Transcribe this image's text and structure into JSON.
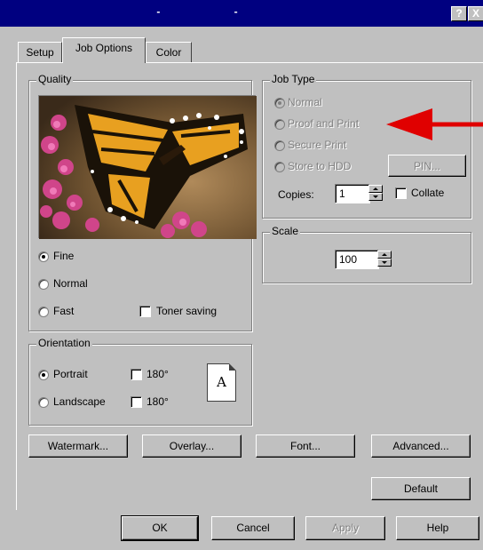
{
  "titlebar": {
    "title": "- -",
    "help_label": "?",
    "close_label": "X"
  },
  "tabs": [
    {
      "label": "Setup"
    },
    {
      "label": "Job Options"
    },
    {
      "label": "Color"
    }
  ],
  "quality": {
    "title": "Quality",
    "options": [
      {
        "label": "Fine",
        "selected": true
      },
      {
        "label": "Normal",
        "selected": false
      },
      {
        "label": "Fast",
        "selected": false
      }
    ],
    "toner_saving": {
      "label": "Toner saving",
      "checked": false
    }
  },
  "job_type": {
    "title": "Job Type",
    "options": [
      {
        "label": "Normal",
        "selected": true,
        "disabled": true
      },
      {
        "label": "Proof and Print",
        "selected": false,
        "disabled": true
      },
      {
        "label": "Secure Print",
        "selected": false,
        "disabled": true
      },
      {
        "label": "Store to HDD",
        "selected": false,
        "disabled": true
      }
    ],
    "pin_button": "PIN...",
    "copies_label": "Copies:",
    "copies_value": "1",
    "collate": {
      "label": "Collate",
      "checked": false
    }
  },
  "scale": {
    "title": "Scale",
    "value": "100"
  },
  "orientation": {
    "title": "Orientation",
    "portrait": {
      "label": "Portrait",
      "selected": true
    },
    "landscape": {
      "label": "Landscape",
      "selected": false
    },
    "rotate_180_label": "180°",
    "page_letter": "A"
  },
  "action_buttons": {
    "watermark": "Watermark...",
    "overlay": "Overlay...",
    "font": "Font...",
    "advanced": "Advanced...",
    "default": "Default"
  },
  "footer_buttons": {
    "ok": "OK",
    "cancel": "Cancel",
    "apply": "Apply",
    "help": "Help"
  },
  "annotation": {
    "arrow_color": "#e00000"
  }
}
